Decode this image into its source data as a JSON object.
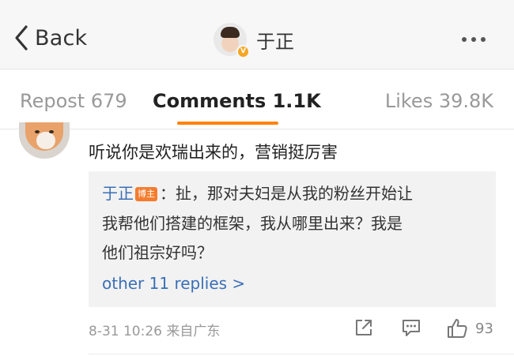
{
  "nav": {
    "back_label": "Back",
    "profile_name": "于正",
    "verified_badge": "V"
  },
  "tabs": {
    "reposts": "Repost 679",
    "comments": "Comments 1.1K",
    "likes": "Likes 39.8K",
    "active_tab": "comments",
    "accent_color": "#ff8200"
  },
  "comment": {
    "text": "听说你是欢瑞出来的，营销挺厉害",
    "reply": {
      "author": "于正",
      "author_badge": "博主",
      "line1": "：扯，那对夫妇是从我的粉丝开始让",
      "line2": "我帮他们搭建的框架，我从哪里出来？我是",
      "line3": "他们祖宗好吗？",
      "more_replies": "other 11 replies >"
    },
    "timestamp": "8-31 10:26",
    "source": "来自广东",
    "like_count": "93"
  },
  "icons": {
    "back": "chevron-left-icon",
    "more": "more-dots-icon",
    "share": "share-icon",
    "comment": "comment-icon",
    "like": "thumbs-up-icon"
  },
  "colors": {
    "link_blue": "#3b6fb6",
    "badge_orange": "#f47c2e",
    "verified_orange": "#f5a623"
  }
}
